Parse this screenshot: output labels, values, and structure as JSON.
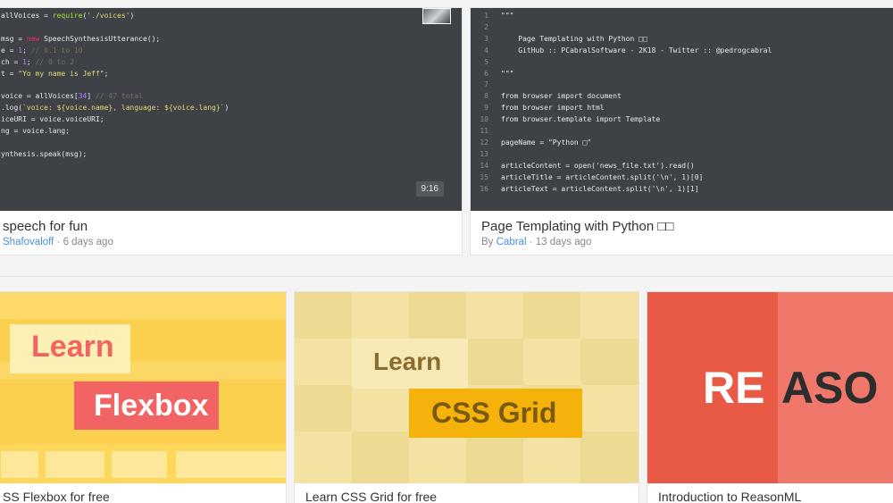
{
  "top_cards": [
    {
      "code_lines": [
        {
          "n": "",
          "html": "allVoices = <span class='fn'>require</span>(<span class='str'>'./voices'</span>)"
        },
        {
          "n": "",
          "html": ""
        },
        {
          "n": "",
          "html": "msg = <span class='kw'>new</span> SpeechSynthesisUtterance();"
        },
        {
          "n": "",
          "html": "e = <span class='num'>1</span>; <span class='cm'>// 0.1 to 10</span>"
        },
        {
          "n": "",
          "html": "ch = <span class='num'>1</span>; <span class='cm'>// 0 to 2</span>"
        },
        {
          "n": "",
          "html": "t = <span class='str'>\"Yo my name is Jeff\"</span>;"
        },
        {
          "n": "",
          "html": ""
        },
        {
          "n": "",
          "html": "voice = allVoices[<span class='num'>34</span>] <span class='cm'>// 47 total</span>"
        },
        {
          "n": "",
          "html": ".log(<span class='str'>`voice: ${voice.name}, language: ${voice.lang}`</span>)"
        },
        {
          "n": "",
          "html": "iceURI = voice.voiceURI;"
        },
        {
          "n": "",
          "html": "ng = voice.lang;"
        },
        {
          "n": "",
          "html": ""
        },
        {
          "n": "",
          "html": "ynthesis.speak(msg);"
        }
      ],
      "duration": "9:16",
      "title": "speech for fun",
      "author": "Shafovaloff",
      "age": "· 6 days ago"
    },
    {
      "code_lines": [
        {
          "n": "1",
          "html": "\"\"\""
        },
        {
          "n": "2",
          "html": ""
        },
        {
          "n": "3",
          "html": "    Page Templating with Python □□"
        },
        {
          "n": "4",
          "html": "    GitHub :: PCabralSoftware - 2K18 - Twitter :: @pedrogcabral"
        },
        {
          "n": "5",
          "html": ""
        },
        {
          "n": "6",
          "html": "\"\"\""
        },
        {
          "n": "7",
          "html": ""
        },
        {
          "n": "8",
          "html": "from browser import document"
        },
        {
          "n": "9",
          "html": "from browser import html"
        },
        {
          "n": "10",
          "html": "from browser.template import Template"
        },
        {
          "n": "11",
          "html": ""
        },
        {
          "n": "12",
          "html": "pageName = \"Python □\""
        },
        {
          "n": "13",
          "html": ""
        },
        {
          "n": "14",
          "html": "articleContent = open('news_file.txt').read()"
        },
        {
          "n": "15",
          "html": "articleTitle = articleContent.split('\\n', 1)[0]"
        },
        {
          "n": "16",
          "html": "articleText = articleContent.split('\\n', 1)[1]"
        }
      ],
      "title": "Page Templating with Python □□",
      "by": "By",
      "author": "Cabral",
      "age": "· 13 days ago"
    }
  ],
  "bottom_cards": [
    {
      "title": "SS Flexbox for free",
      "word1": "Learn",
      "word2": "Flexbox"
    },
    {
      "title": "Learn CSS Grid for free",
      "word1": "Learn",
      "word2": "CSS Grid"
    },
    {
      "title": "Introduction to ReasonML",
      "word1": "RE",
      "word2": "ASO"
    }
  ],
  "colors": {
    "code_bg": "#3e4247",
    "link": "#4a90d9",
    "flex_bg": "#fbd04f",
    "flex_red": "#f26363",
    "grid_bg": "#f4e2a3",
    "grid_yellow": "#f5b20a",
    "reason_bg": "#e85a45"
  }
}
